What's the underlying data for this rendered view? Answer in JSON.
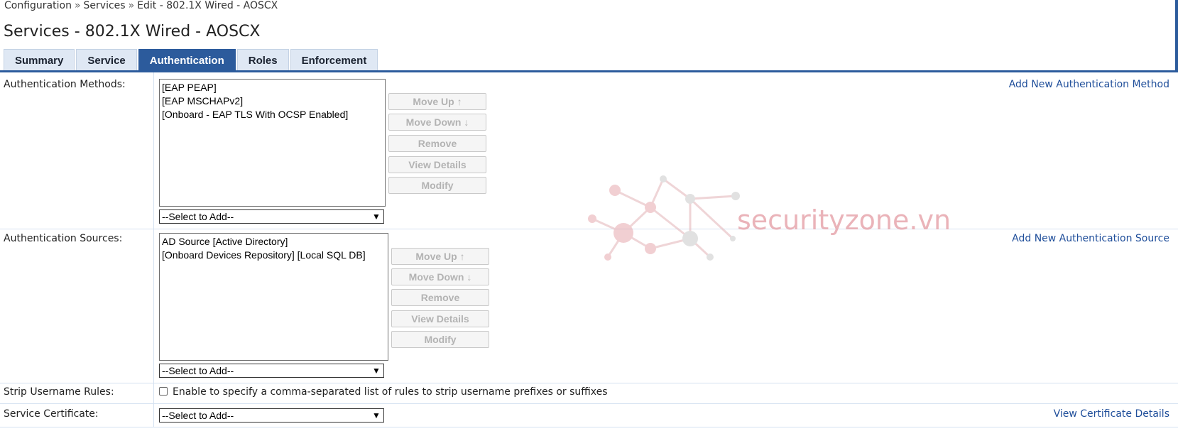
{
  "breadcrumb": {
    "items": [
      "Configuration",
      "Services",
      "Edit - 802.1X Wired - AOSCX"
    ],
    "separator": "»"
  },
  "page": {
    "title": "Services - 802.1X Wired - AOSCX"
  },
  "tabs": [
    {
      "label": "Summary",
      "active": false
    },
    {
      "label": "Service",
      "active": false
    },
    {
      "label": "Authentication",
      "active": true
    },
    {
      "label": "Roles",
      "active": false
    },
    {
      "label": "Enforcement",
      "active": false
    }
  ],
  "auth_methods": {
    "label": "Authentication Methods:",
    "items": [
      "[EAP PEAP]",
      "[EAP MSCHAPv2]",
      "[Onboard - EAP TLS With OCSP Enabled]"
    ],
    "select_value": "--Select to Add--",
    "add_link": "Add New Authentication Method"
  },
  "auth_sources": {
    "label": "Authentication Sources:",
    "items": [
      "AD Source [Active Directory]",
      "[Onboard Devices Repository] [Local SQL DB]"
    ],
    "select_value": "--Select to Add--",
    "add_link": "Add New Authentication Source"
  },
  "buttons": {
    "move_up": "Move Up ↑",
    "move_down": "Move Down ↓",
    "remove": "Remove",
    "view_details": "View Details",
    "modify": "Modify"
  },
  "strip_username": {
    "label": "Strip Username Rules:",
    "checkbox_label": "Enable to specify a comma-separated list of rules to strip username prefixes or suffixes",
    "checked": false
  },
  "service_certificate": {
    "label": "Service Certificate:",
    "select_value": "--Select to Add--",
    "link": "View Certificate Details"
  },
  "watermark": {
    "text": "securityzone.vn"
  },
  "colors": {
    "accent": "#2c5b9c",
    "link": "#1f4e9a",
    "tab_bg": "#dfe8f4",
    "disabled_text": "#b3b3b3"
  }
}
